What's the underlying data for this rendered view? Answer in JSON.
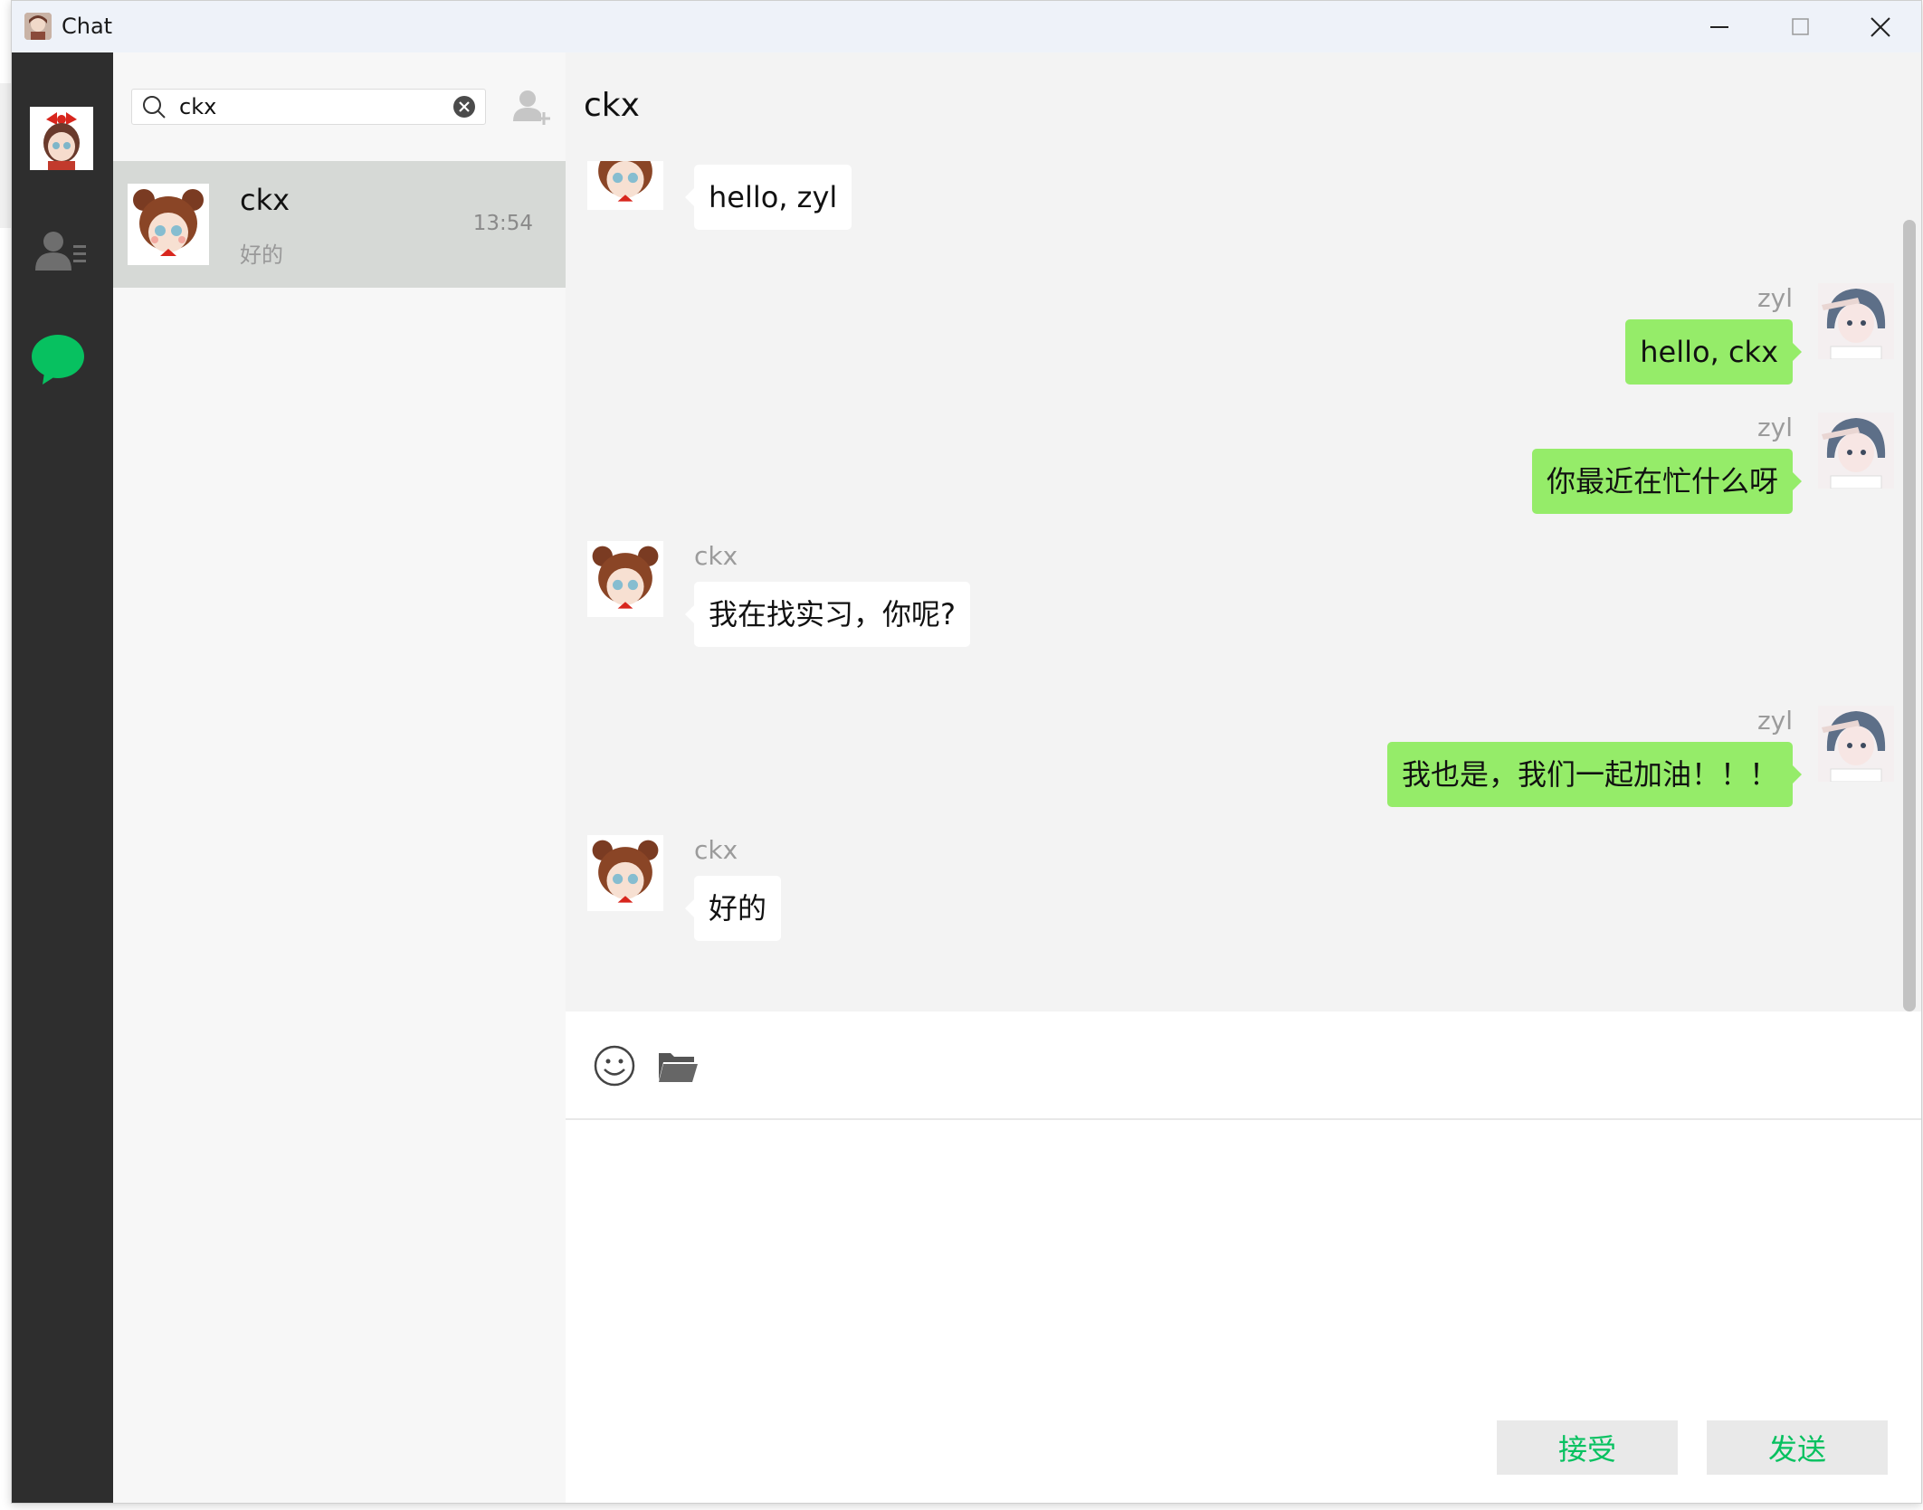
{
  "window": {
    "title": "Chat"
  },
  "colors": {
    "rail_bg": "#2e2e2e",
    "list_bg": "#f7f7f7",
    "selected_item_bg": "#d6d9d6",
    "chat_bg": "#f3f3f3",
    "bubble_self": "#95ec69",
    "bubble_other": "#ffffff",
    "accent_green": "#07c160"
  },
  "rail": {
    "items": [
      {
        "icon": "user-avatar"
      },
      {
        "icon": "contacts-icon"
      },
      {
        "icon": "chat-bubble-icon"
      }
    ]
  },
  "search": {
    "value": "ckx",
    "placeholder": ""
  },
  "sessions": [
    {
      "name": "ckx",
      "preview": "好的",
      "time": "13:54"
    }
  ],
  "chat": {
    "title": "ckx",
    "messages": [
      {
        "side": "left",
        "sender": "",
        "text": "hello, zyl"
      },
      {
        "side": "right",
        "sender": "zyl",
        "text": "hello, ckx"
      },
      {
        "side": "right",
        "sender": "zyl",
        "text": "你最近在忙什么呀"
      },
      {
        "side": "left",
        "sender": "ckx",
        "text": "我在找实习，你呢?"
      },
      {
        "side": "right",
        "sender": "zyl",
        "text": "我也是，我们一起加油！！！"
      },
      {
        "side": "left",
        "sender": "ckx",
        "text": "好的"
      }
    ]
  },
  "input": {
    "value": "",
    "accept_label": "接受",
    "send_label": "发送"
  }
}
